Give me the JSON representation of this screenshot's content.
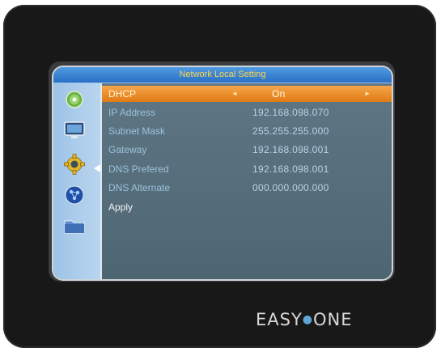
{
  "window": {
    "title": "Network Local Setting"
  },
  "settings": [
    {
      "label": "DHCP",
      "value": "On"
    },
    {
      "label": "IP Address",
      "value": "192.168.098.070"
    },
    {
      "label": "Subnet Mask",
      "value": "255.255.255.000"
    },
    {
      "label": "Gateway",
      "value": "192.168.098.001"
    },
    {
      "label": "DNS Prefered",
      "value": "192.168.098.001"
    },
    {
      "label": "DNS Alternate",
      "value": "000.000.000.000"
    }
  ],
  "apply_label": "Apply",
  "arrows": {
    "left": "◄",
    "right": "►"
  },
  "brand": {
    "left": "EASY",
    "dot": "●",
    "right": "ONE"
  },
  "sidebar": {
    "icons": [
      "disc-icon",
      "monitor-icon",
      "gear-icon",
      "network-globe-icon",
      "folder-icon"
    ],
    "selected_index": 2
  },
  "colors": {
    "title_text": "#ffd54a",
    "highlight": "#e88a22",
    "panel": "#5d7582",
    "sidebar": "#aac9e8"
  }
}
